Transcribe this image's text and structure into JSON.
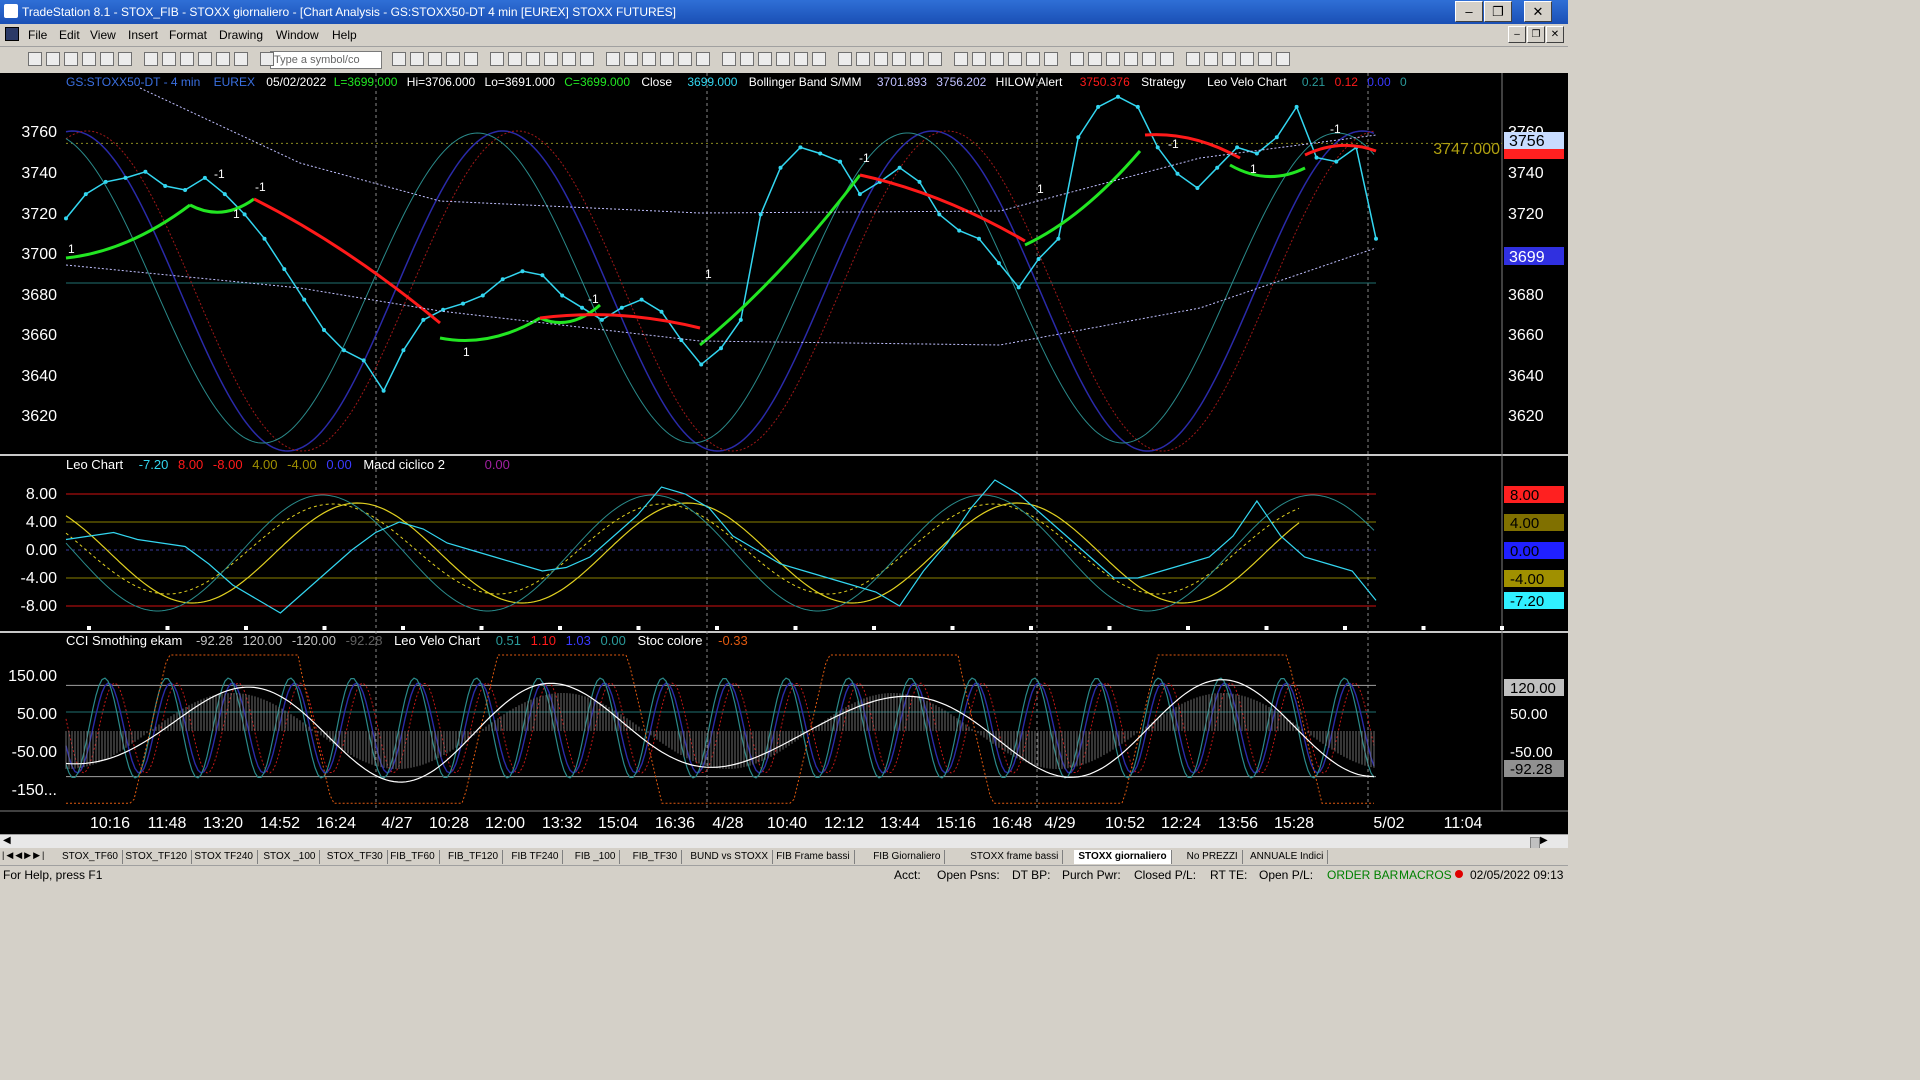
{
  "window": {
    "title": "TradeStation 8.1 - STOX_FIB - STOXX giornaliero - [Chart Analysis - GS:STOXX50-DT  4 min  [EUREX] STOXX FUTURES]"
  },
  "menu": [
    "File",
    "Edit",
    "View",
    "Insert",
    "Format",
    "Drawing",
    "Window",
    "Help"
  ],
  "toolbar": {
    "symbol_placeholder": "Type a symbol/co"
  },
  "header": {
    "symbol": "GS:STOXX50-DT - 4 min",
    "exchange": "EUREX",
    "date": "05/02/2022",
    "last": "L=3699.000",
    "high": "Hi=3706.000",
    "low": "Lo=3691.000",
    "close_eq": "C=3699.000",
    "close_label": "Close",
    "close_value": "3699.000",
    "bb_label": "Bollinger Band S/MM",
    "bb_v1": "3701.893",
    "bb_v2": "3756.202",
    "hilow_label": "HILOW Alert",
    "hilow_value": "3750.376",
    "strategy_label": "Strategy",
    "velo_label": "Leo Velo Chart",
    "velo_v1": "0.21",
    "velo_v2": "0.12",
    "velo_v3": "0.00",
    "velo_v4": "0"
  },
  "price_panel": {
    "y_labels": [
      "3760",
      "3740",
      "3720",
      "3700",
      "3680",
      "3660",
      "3640",
      "3620"
    ],
    "hline_label": "3747.000",
    "tag_top": "3756",
    "tag_cur": "3699",
    "signals": [
      "1",
      "-1",
      "1",
      "-1",
      "1",
      "-1",
      "1",
      "-1",
      "1",
      "-1",
      "1",
      "-1",
      "1",
      "-1"
    ]
  },
  "leo_panel": {
    "label": "Leo Chart",
    "v1": "-7.20",
    "v2": "8.00",
    "v3": "-8.00",
    "v4": "4.00",
    "v5": "-4.00",
    "v6": "0.00",
    "macd_label": "Macd ciclico 2",
    "macd_v": "0.00",
    "y_labels": [
      "8.00",
      "4.00",
      "0.00",
      "-4.00",
      "-8.00"
    ],
    "tags": [
      "8.00",
      "4.00",
      "0.00",
      "-4.00",
      "-7.20"
    ]
  },
  "cci_panel": {
    "label": "CCI Smothing ekam",
    "v1": "-92.28",
    "v2": "120.00",
    "v3": "-120.00",
    "v4": "-92.28",
    "velo_label": "Leo Velo Chart",
    "velo_v1": "0.51",
    "velo_v2": "1.10",
    "velo_v3": "1.03",
    "velo_v4": "0.00",
    "stoc_label": "Stoc colore",
    "stoc_v": "-0.33",
    "y_labels": [
      "150.00",
      "50.00",
      "-50.00",
      "-150..."
    ],
    "tags": [
      "120.00",
      "50.00",
      "-50.00",
      "-92.28"
    ]
  },
  "x_labels": [
    "10:16",
    "11:48",
    "13:20",
    "14:52",
    "16:24",
    "4/27",
    "10:28",
    "12:00",
    "13:32",
    "15:04",
    "16:36",
    "4/28",
    "10:40",
    "12:12",
    "13:44",
    "15:16",
    "16:48",
    "4/29",
    "10:52",
    "12:24",
    "13:56",
    "15:28",
    "5/02",
    "11:04"
  ],
  "tabs": [
    "STOX_TF60",
    "STOX_TF120",
    "STOX TF240",
    "STOX _100",
    "STOX_TF30",
    "FIB_TF60",
    "FIB_TF120",
    "FIB TF240",
    "FIB _100",
    "FIB_TF30",
    "BUND vs STOXX",
    "FIB Frame bassi",
    "FIB Giornaliero",
    "STOXX frame bassi",
    "STOXX giornaliero",
    "No PREZZI",
    "ANNUALE Indici"
  ],
  "active_tab": "STOXX giornaliero",
  "status": {
    "help": "For Help, press F1",
    "acct": "Acct:",
    "open_psns": "Open Psns:",
    "dt_bp": "DT BP:",
    "purch_pwr": "Purch Pwr:",
    "closed_pl": "Closed P/L:",
    "rt_te": "RT TE:",
    "open_pl": "Open P/L:",
    "order_bar": "ORDER BAR",
    "macros": "MACROS",
    "datetime": "02/05/2022 09:13"
  },
  "colors": {
    "bg": "#000000",
    "price": "#33d6f0",
    "bear": "#ff1a1a",
    "bull": "#22e622",
    "yellow": "#e0d020",
    "navy": "#2a2aa8",
    "teal": "#2a8a8a"
  },
  "chart_data": {
    "type": "line",
    "title": "",
    "x_ticks": [
      "10:16",
      "11:48",
      "13:20",
      "14:52",
      "16:24",
      "4/27",
      "10:28",
      "12:00",
      "13:32",
      "15:04",
      "16:36",
      "4/28",
      "10:40",
      "12:12",
      "13:44",
      "15:16",
      "16:48",
      "4/29",
      "10:52",
      "12:24",
      "13:56",
      "15:28",
      "5/02",
      "11:04"
    ],
    "price_ylim": [
      3610,
      3775
    ],
    "price_series": [
      3710,
      3722,
      3728,
      3730,
      3733,
      3726,
      3724,
      3730,
      3722,
      3712,
      3700,
      3685,
      3670,
      3655,
      3645,
      3640,
      3625,
      3645,
      3660,
      3665,
      3668,
      3672,
      3680,
      3684,
      3682,
      3672,
      3666,
      3660,
      3666,
      3670,
      3664,
      3650,
      3638,
      3646,
      3660,
      3712,
      3735,
      3745,
      3742,
      3738,
      3722,
      3728,
      3735,
      3728,
      3712,
      3704,
      3700,
      3688,
      3676,
      3690,
      3700,
      3750,
      3765,
      3770,
      3765,
      3745,
      3732,
      3725,
      3735,
      3745,
      3742,
      3750,
      3765,
      3740,
      3738,
      3745,
      3700
    ],
    "leo_ylim": [
      -10,
      11
    ],
    "leo_series": [
      1.5,
      2,
      2.5,
      1.5,
      1,
      0.5,
      -2,
      -5,
      -7,
      -9,
      -6,
      -3,
      0,
      2.5,
      4,
      3,
      1,
      0,
      -1,
      -2,
      -3,
      -2.5,
      -1,
      2,
      5,
      9,
      8,
      6,
      2,
      0,
      -2,
      -3,
      -4,
      -5,
      -6,
      -8,
      -3,
      1,
      6,
      10,
      8,
      5,
      2,
      -1,
      -4,
      -4,
      -3,
      -2,
      -1,
      2,
      7,
      2,
      -1,
      -2,
      -3,
      -7.2
    ],
    "cci_ylim": [
      -195,
      230
    ],
    "hlines": {
      "price": [
        3747
      ],
      "leo": [
        8,
        4,
        0,
        -4,
        -8
      ],
      "cci": [
        120,
        50,
        -120
      ]
    }
  }
}
